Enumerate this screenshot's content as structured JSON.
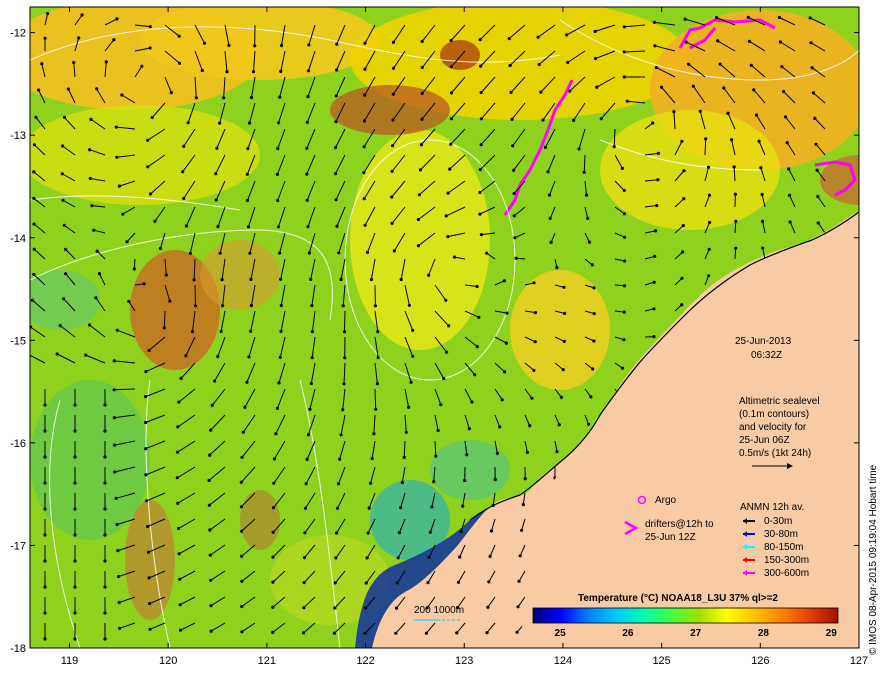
{
  "map": {
    "lon_range": [
      118.6,
      127.0
    ],
    "lat_range": [
      -18.0,
      -11.75
    ],
    "lon_ticks": [
      "119",
      "120",
      "121",
      "122",
      "123",
      "124",
      "125",
      "126",
      "127"
    ],
    "lat_ticks": [
      "-12",
      "-13",
      "-14",
      "-15",
      "-16",
      "-17",
      "-18"
    ],
    "land_color": "#f8cba5",
    "ocean_base_color": "#8fd21e"
  },
  "annotations": {
    "date": "25-Jun-2013",
    "time": "06:32Z",
    "altimetry_lines": [
      "Altimetric sealevel",
      "(0.1m contours)",
      "and velocity for",
      "25-Jun 06Z",
      "0.5m/s (1kt 24h)"
    ],
    "argo_label": "Argo",
    "drifters_lines": [
      "drifters@12h to",
      "25-Jun 12Z"
    ],
    "anmn_title": "ANMN 12h av.",
    "anmn_items": [
      {
        "label": "0-30m",
        "color": "#000000"
      },
      {
        "label": "30-80m",
        "color": "#0000ff"
      },
      {
        "label": "80-150m",
        "color": "#00ffff"
      },
      {
        "label": "150-300m",
        "color": "#ff0000"
      },
      {
        "label": "300-600m",
        "color": "#ff00ff"
      }
    ],
    "isobath_label": "200  1000m",
    "credit": "© IMOS 08-Apr-2015 09:19:04 Hobart time"
  },
  "colorbar": {
    "title": "Temperature (°C) NOAA18_L3U 37% ql>=2",
    "ticks": [
      "25",
      "26",
      "27",
      "28",
      "29"
    ],
    "range": [
      24.6,
      29.1
    ],
    "colors": [
      "#000080",
      "#0000ff",
      "#0080ff",
      "#00c8ff",
      "#00ffb0",
      "#40ff40",
      "#a0e000",
      "#ffff00",
      "#ffc000",
      "#ff8000",
      "#e04000",
      "#a01000"
    ]
  }
}
